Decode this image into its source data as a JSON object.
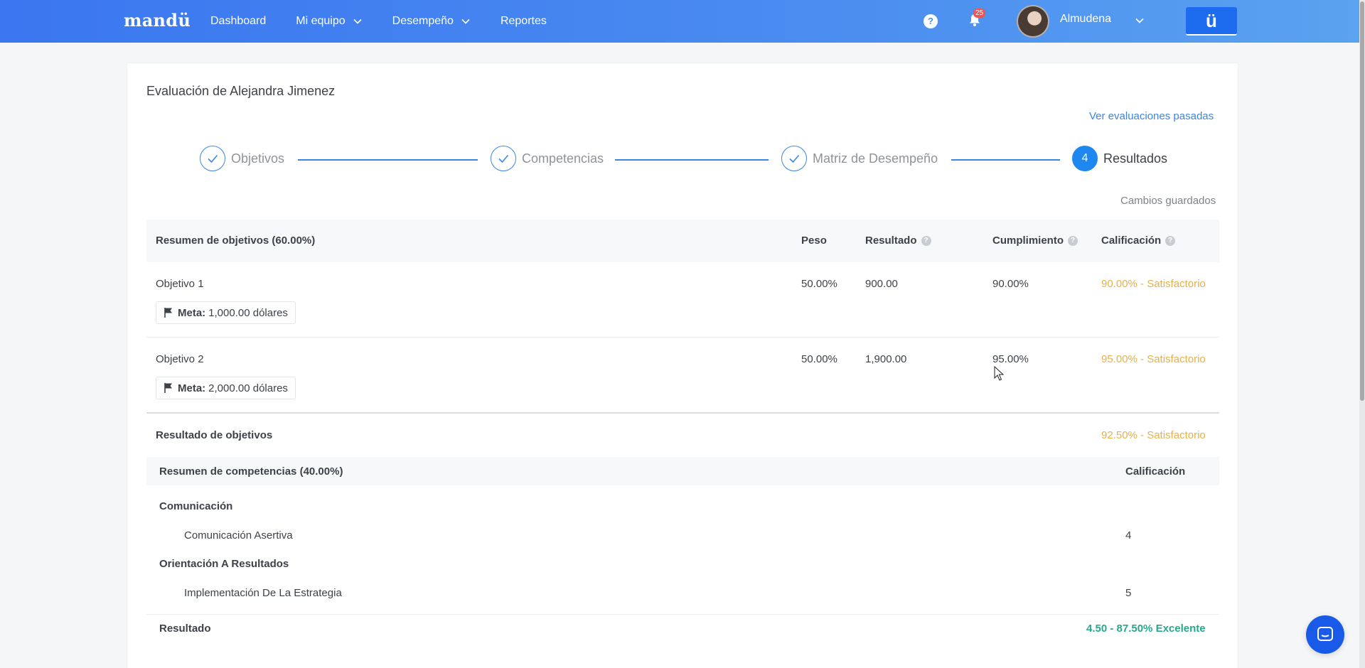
{
  "nav": {
    "logo": "mandü",
    "items": [
      {
        "label": "Dashboard",
        "has_menu": false
      },
      {
        "label": "Mi equipo",
        "has_menu": true
      },
      {
        "label": "Desempeño",
        "has_menu": true
      },
      {
        "label": "Reportes",
        "has_menu": false
      }
    ],
    "help_icon": "?",
    "notifications_count": "25",
    "user_name": "Almudena",
    "brand_button": "ü"
  },
  "page": {
    "title": "Evaluación de Alejandra Jimenez",
    "past_link": "Ver evaluaciones pasadas",
    "saved_status": "Cambios guardados",
    "steps": [
      {
        "label": "Objetivos",
        "state": "done"
      },
      {
        "label": "Competencias",
        "state": "done"
      },
      {
        "label": "Matriz de Desempeño",
        "state": "done"
      },
      {
        "label": "Resultados",
        "state": "active",
        "number": "4"
      }
    ]
  },
  "objectives": {
    "header": {
      "summary": "Resumen de objetivos (60.00%)",
      "weight": "Peso",
      "result": "Resultado",
      "compliance": "Cumplimiento",
      "rating": "Calificación"
    },
    "rows": [
      {
        "name": "Objetivo 1",
        "weight": "50.00%",
        "result": "900.00",
        "compliance": "90.00%",
        "rating": "90.00% - Satisfactorio",
        "goal_label": "Meta:",
        "goal_value": "1,000.00 dólares"
      },
      {
        "name": "Objetivo 2",
        "weight": "50.00%",
        "result": "1,900.00",
        "compliance": "95.00%",
        "rating": "95.00% - Satisfactorio",
        "goal_label": "Meta:",
        "goal_value": "2,000.00 dólares"
      }
    ],
    "total_label": "Resultado de objetivos",
    "total_rating": "92.50% - Satisfactorio"
  },
  "competencies": {
    "header": {
      "summary": "Resumen de competencias (40.00%)",
      "rating": "Calificación"
    },
    "groups": [
      {
        "name": "Comunicación",
        "items": [
          {
            "name": "Comunicación Asertiva",
            "score": "4"
          }
        ]
      },
      {
        "name": "Orientación A Resultados",
        "items": [
          {
            "name": "Implementación De La Estrategia",
            "score": "5"
          }
        ]
      }
    ],
    "result_label": "Resultado",
    "result_value": "4.50 - 87.50% Excelente"
  },
  "colors": {
    "accent": "#1e87f0",
    "rating_yellow": "#e8b04a",
    "rating_green": "#29a88a"
  }
}
